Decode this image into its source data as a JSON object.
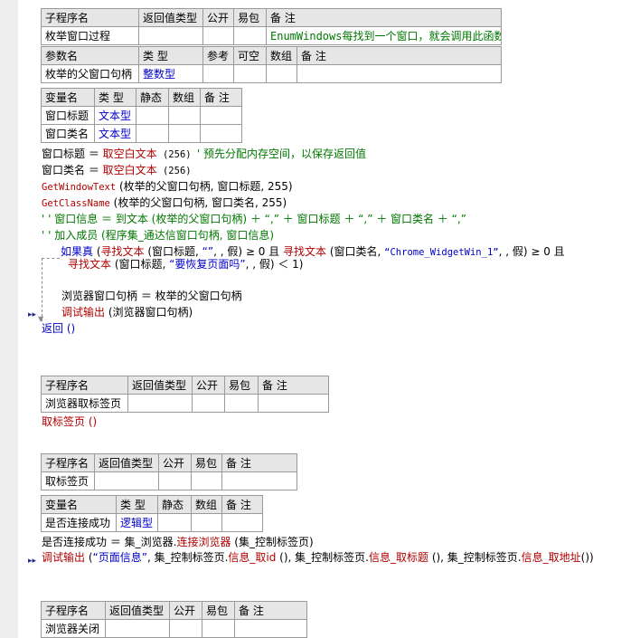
{
  "sub1": {
    "header": [
      "子程序名",
      "返回值类型",
      "公开",
      "易包",
      "备 注"
    ],
    "name": "枚举窗口过程",
    "note": "EnumWindows每找到一个窗口，就会调用此函数",
    "param_header": [
      "参数名",
      "类 型",
      "参考",
      "可空",
      "数组",
      "备 注"
    ],
    "param": {
      "name": "枚举的父窗口句柄",
      "type": "整数型"
    },
    "var_header": [
      "变量名",
      "类 型",
      "静态",
      "数组",
      "备 注"
    ],
    "vars": [
      {
        "name": "窗口标题",
        "type": "文本型"
      },
      {
        "name": "窗口类名",
        "type": "文本型"
      }
    ]
  },
  "code1": {
    "l1": {
      "lhs": "窗口标题 ＝ ",
      "fn": "取空白文本",
      "args": " (256) ",
      "comment": "' 预先分配内存空间，以保存返回值"
    },
    "l2": {
      "lhs": "窗口类名 ＝ ",
      "fn": "取空白文本",
      "args": " (256)"
    },
    "l3": {
      "fn": "GetWindowText",
      "args": " (枚举的父窗口句柄, 窗口标题, 255)"
    },
    "l4": {
      "fn": "GetClassName",
      "args": " (枚举的父窗口句柄, 窗口类名, 255)"
    },
    "l5": "' ' 窗口信息 ＝ 到文本 (枚举的父窗口句柄) ＋ “,” ＋ 窗口标题 ＋ “,” ＋ 窗口类名 ＋ “,”",
    "l6": "' ' 加入成员 (程序集_通达信窗口句柄, 窗口信息)",
    "if1": {
      "kw": "如果真",
      "a1": " (",
      "f1": "寻找文本",
      "a2": " (窗口标题, ",
      "s1": "“”",
      "a3": ", , 假) ≥ 0 且 ",
      "f2": "寻找文本",
      "a4": " (窗口类名, ",
      "s2": "“Chrome_WidgetWin_1”",
      "a5": ", , 假) ≥ 0 且"
    },
    "if2": {
      "f": "寻找文本",
      "a1": " (窗口标题, ",
      "s": "“要恢复页面吗”",
      "a2": ", , 假) ＜ 1)"
    },
    "b1": "浏览器窗口句柄 ＝ 枚举的父窗口句柄",
    "b2": {
      "fn": "调试输出",
      "args": " (浏览器窗口句柄)"
    },
    "ret": "返回 ()"
  },
  "sub2": {
    "header": [
      "子程序名",
      "返回值类型",
      "公开",
      "易包",
      "备 注"
    ],
    "name": "浏览器取标签页",
    "code": "取标签页 ()"
  },
  "sub3": {
    "header": [
      "子程序名",
      "返回值类型",
      "公开",
      "易包",
      "备 注"
    ],
    "name": "取标签页",
    "var_header": [
      "变量名",
      "类 型",
      "静态",
      "数组",
      "备 注"
    ],
    "var": {
      "name": "是否连接成功",
      "type": "逻辑型"
    },
    "c1": {
      "lhs": "是否连接成功 ＝ 集_浏览器.",
      "m": "连接浏览器",
      "rest": " (集_控制标签页)"
    },
    "c2": {
      "fn": "调试输出",
      "a1": " (",
      "s": "“页面信息”",
      "a2": ", 集_控制标签页.",
      "m1": "信息_取id",
      "a3": " (), 集_控制标签页.",
      "m2": "信息_取标题",
      "a4": " (), 集_控制标签页.",
      "m3": "信息_取地址",
      "a5": "())"
    }
  },
  "sub4": {
    "header": [
      "子程序名",
      "返回值类型",
      "公开",
      "易包",
      "备 注"
    ],
    "name": "浏览器关闭"
  }
}
